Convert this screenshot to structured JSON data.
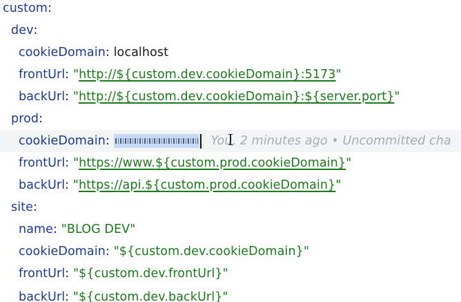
{
  "editor": {
    "lines": {
      "l1": {
        "key": "custom"
      },
      "l2": {
        "key": "dev"
      },
      "l3": {
        "key": "cookieDomain",
        "value": "localhost"
      },
      "l4": {
        "key": "frontUrl",
        "value": "http://${custom.dev.cookieDomain}:5173"
      },
      "l5": {
        "key": "backUrl",
        "value": "http://${custom.dev.cookieDomain}:${server.port}"
      },
      "l6": {
        "key": "prod"
      },
      "l7": {
        "key": "cookieDomain",
        "blame": "You, 2 minutes ago • Uncommitted cha"
      },
      "l8": {
        "key": "frontUrl",
        "value": "https://www.${custom.prod.cookieDomain}"
      },
      "l9": {
        "key": "backUrl",
        "value": "https://api.${custom.prod.cookieDomain}"
      },
      "l10": {
        "key": "site"
      },
      "l11": {
        "key": "name",
        "value": "BLOG DEV"
      },
      "l12": {
        "key": "cookieDomain",
        "value": "${custom.dev.cookieDomain}"
      },
      "l13": {
        "key": "frontUrl",
        "value": "${custom.dev.frontUrl}"
      },
      "l14": {
        "key": "backUrl",
        "value": "${custom.dev.backUrl}"
      }
    }
  },
  "colors": {
    "key": "#1c3a94",
    "string": "#1b7a1b",
    "blame": "#a8abb0",
    "selection": "#c6d9f7",
    "current_line": "#f3f4f6"
  },
  "icons": {
    "cursor": "text-cursor-icon"
  }
}
